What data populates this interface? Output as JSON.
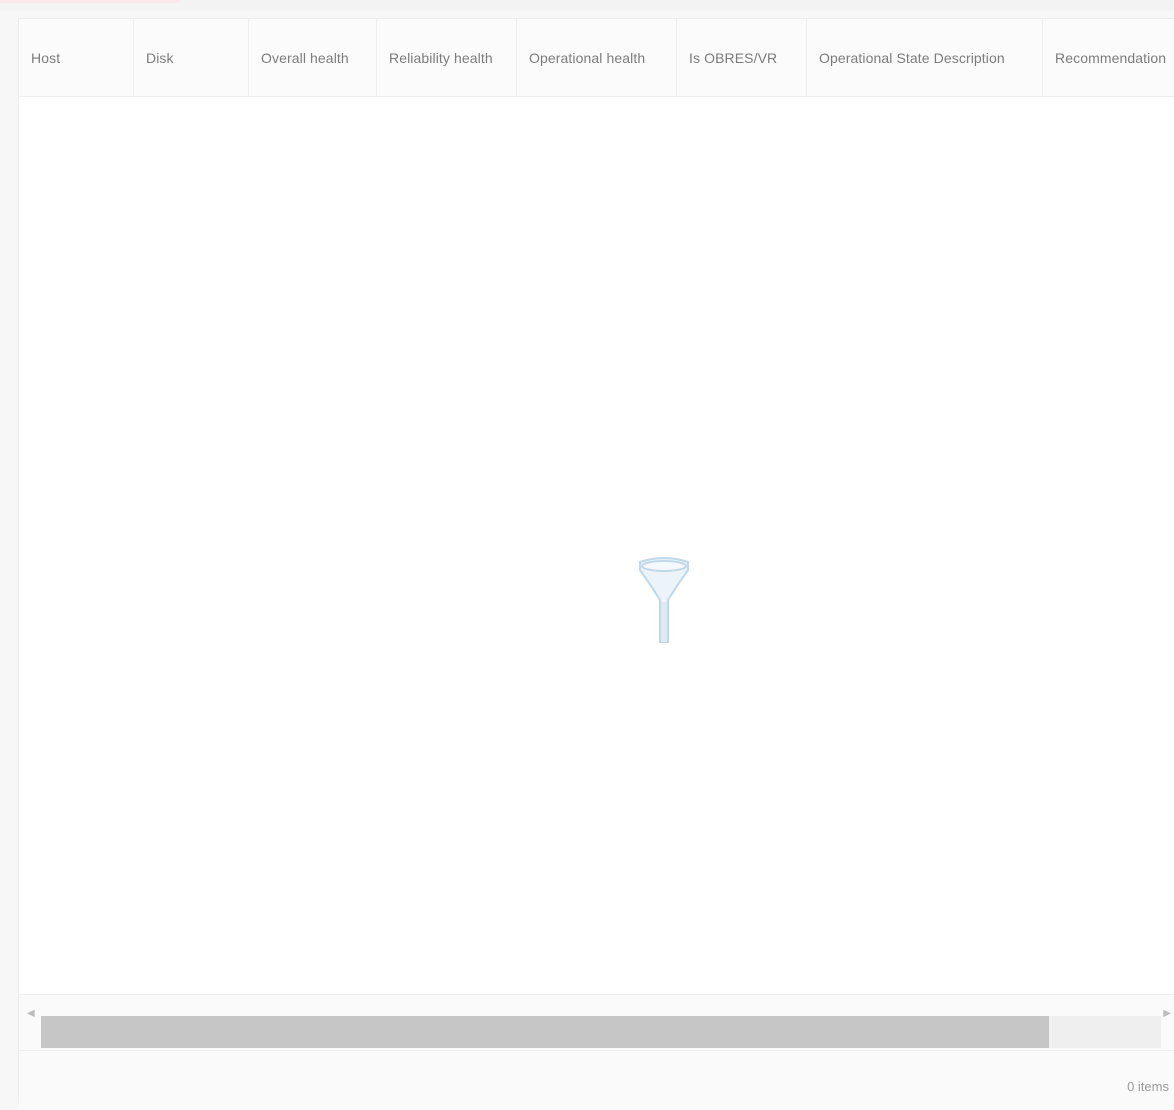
{
  "columns": [
    {
      "label": "Host"
    },
    {
      "label": "Disk"
    },
    {
      "label": "Overall health"
    },
    {
      "label": "Reliability health"
    },
    {
      "label": "Operational health"
    },
    {
      "label": "Is OBRES/VR"
    },
    {
      "label": "Operational State Description"
    },
    {
      "label": "Recommendation"
    }
  ],
  "empty_state": {
    "icon": "funnel-icon",
    "line1": "",
    "line2": ""
  },
  "scrollbar": {
    "thumb_fraction": 0.9
  },
  "footer": {
    "count": "0 items"
  },
  "colors": {
    "accent": "#fde8ea",
    "icon": "#bcd7ea"
  }
}
